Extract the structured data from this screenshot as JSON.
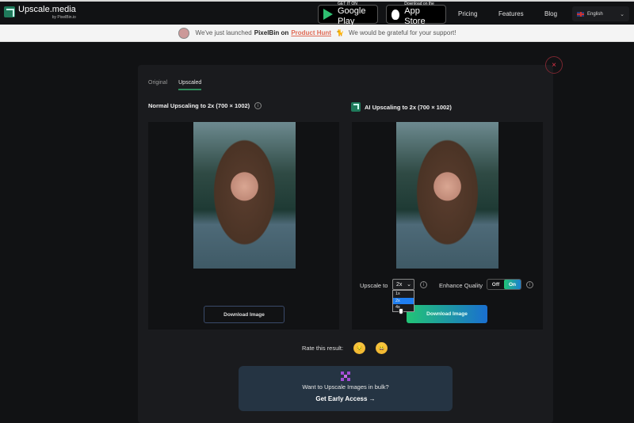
{
  "header": {
    "logo_title": "Upscale.media",
    "logo_sub": "by PixelBin.io",
    "google_play": {
      "small": "GET IT ON",
      "big": "Google Play"
    },
    "app_store": {
      "small": "Download on the",
      "big": "App Store"
    },
    "nav": [
      "Pricing",
      "Features",
      "Blog"
    ],
    "language": "English"
  },
  "banner": {
    "prefix": "We've just launched",
    "brand": "PixelBin on",
    "link": "Product Hunt",
    "suffix": "We would be grateful for your support!"
  },
  "modal": {
    "close_icon": "×",
    "tabs": [
      {
        "label": "Original",
        "active": false
      },
      {
        "label": "Upscaled",
        "active": true
      }
    ],
    "left_panel": {
      "title": "Normal Upscaling to 2x (700 × 1002)",
      "download_label": "Download Image"
    },
    "right_panel": {
      "title": "AI Upscaling to 2x (700 × 1002)",
      "upscale_label": "Upscale to",
      "upscale_value": "2x",
      "upscale_options": [
        "1x",
        "2x",
        "4x"
      ],
      "enhance_label": "Enhance Quality",
      "toggle_off": "Off",
      "toggle_on": "On",
      "download_label": "Download Image"
    },
    "rate_label": "Rate this result:",
    "rate_emojis": [
      "😔",
      "😀"
    ],
    "bulk": {
      "question": "Want to Upscale Images in bulk?",
      "cta": "Get Early Access →"
    }
  }
}
